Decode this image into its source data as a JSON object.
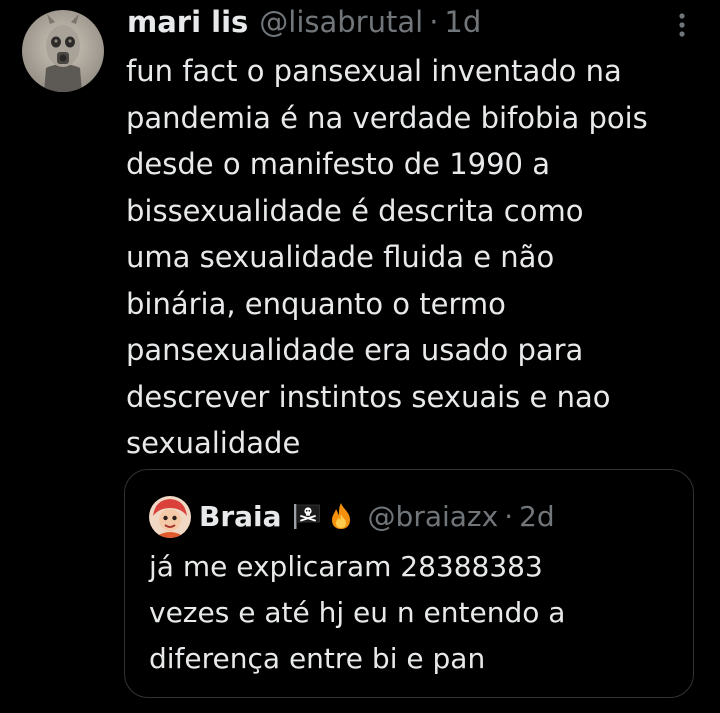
{
  "tweet": {
    "author": {
      "display_name": "mari lis",
      "handle": "@lisabrutal",
      "separator": "·",
      "time": "1d"
    },
    "text": "fun fact o pansexual inventado na\npandemia é na verdade bifobia pois\ndesde o manifesto de 1990 a\nbissexualidade é descrita como\numa sexualidade fluida e não\nbinária, enquanto o termo\npansexualidade era usado para\ndescrever instintos sexuais e nao\nsexualidade",
    "more_icon": "more-horizontal-dots-icon",
    "quote": {
      "author": {
        "display_name": "Braia",
        "emojis": [
          "pirate-flag-icon",
          "fire-icon"
        ],
        "handle": "@braiazx",
        "separator": "·",
        "time": "2d"
      },
      "text": "já me explicaram 28388383\nvezes e até hj eu n entendo a\ndiferença entre bi e pan"
    }
  },
  "colors": {
    "background": "#000000",
    "primary_text": "#e7e9ea",
    "secondary_text": "#71767b",
    "card_border": "#2f3336"
  }
}
